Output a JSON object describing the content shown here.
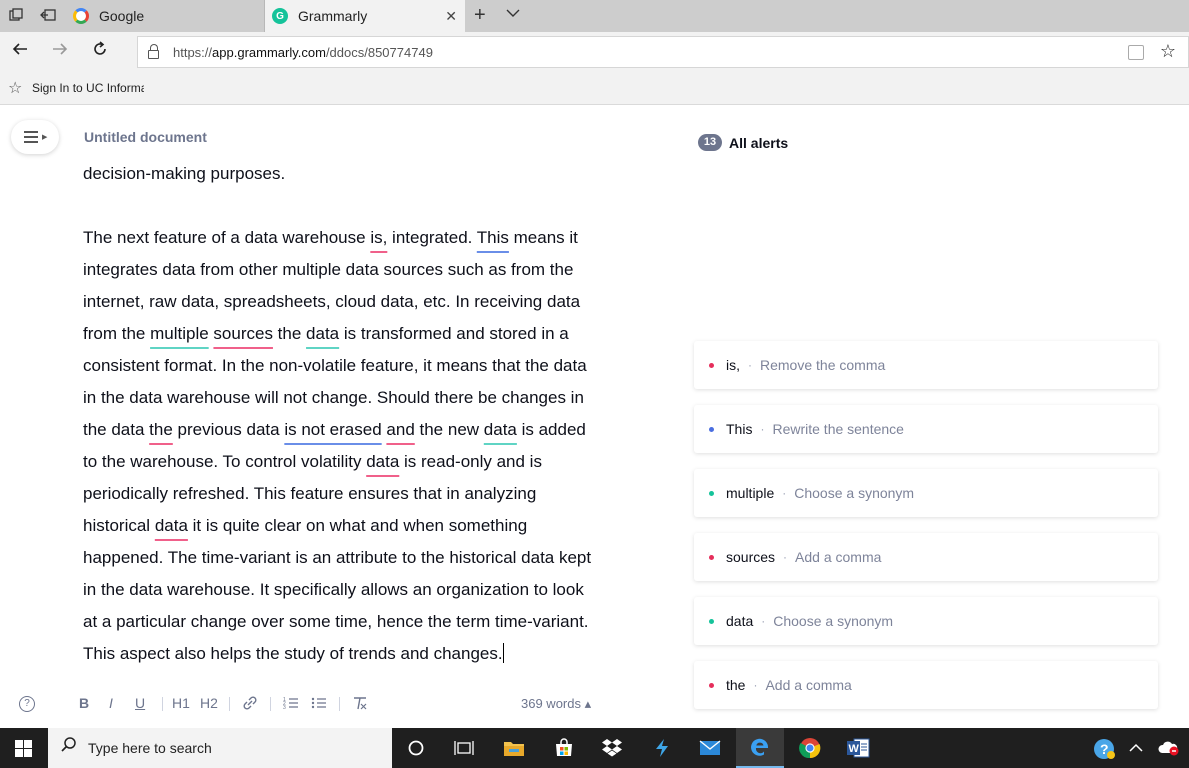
{
  "browser": {
    "tabs": [
      {
        "label": "Google",
        "active": false
      },
      {
        "label": "Grammarly",
        "active": true
      }
    ],
    "url_prefix": "https://",
    "url_domain": "app.grammarly.com",
    "url_path": "/ddocs/850774749",
    "favorites": [
      {
        "label": "Sign In to UC Informa"
      }
    ]
  },
  "editor": {
    "doc_title": "Untitled document",
    "prev_line": "decision-making purposes.",
    "lines": [
      [
        {
          "t": "The next feature of a data warehouse "
        },
        {
          "t": "is,",
          "u": "red"
        },
        {
          "t": " integrated. "
        },
        {
          "t": "This",
          "u": "blue"
        },
        {
          "t": " means it"
        }
      ],
      [
        {
          "t": "integrates data from other multiple data sources such as from the"
        }
      ],
      [
        {
          "t": "internet, raw data, spreadsheets, cloud data, etc. In receiving data"
        }
      ],
      [
        {
          "t": "from the "
        },
        {
          "t": "multiple",
          "u": "green"
        },
        {
          "t": " "
        },
        {
          "t": "sources",
          "u": "red"
        },
        {
          "t": " the "
        },
        {
          "t": "data",
          "u": "green"
        },
        {
          "t": " is transformed and stored in a"
        }
      ],
      [
        {
          "t": "consistent format. In the non-volatile feature, it means that the data"
        }
      ],
      [
        {
          "t": "in the data warehouse will not change. Should there be changes in"
        }
      ],
      [
        {
          "t": "the data "
        },
        {
          "t": "the",
          "u": "red"
        },
        {
          "t": " previous data "
        },
        {
          "t": "is not erased",
          "u": "blue"
        },
        {
          "t": " "
        },
        {
          "t": "and",
          "u": "red"
        },
        {
          "t": " the new "
        },
        {
          "t": "data",
          "u": "green"
        },
        {
          "t": " is added"
        }
      ],
      [
        {
          "t": "to the warehouse. To control volatility "
        },
        {
          "t": "data",
          "u": "red"
        },
        {
          "t": " is read-only and is"
        }
      ],
      [
        {
          "t": "periodically refreshed. This feature ensures that in analyzing"
        }
      ],
      [
        {
          "t": "historical "
        },
        {
          "t": "data",
          "u": "red"
        },
        {
          "t": " it is quite clear on what and when something"
        }
      ],
      [
        {
          "t": "happened. The time-variant is an attribute to the historical data kept"
        }
      ],
      [
        {
          "t": "in the data warehouse. It specifically allows an organization to look"
        }
      ],
      [
        {
          "t": "at a particular change over some time, hence the term time-variant."
        }
      ],
      [
        {
          "t": "This aspect also helps the study of trends and changes."
        }
      ]
    ],
    "toolbar": {
      "bold": "B",
      "italic": "I",
      "underline": "U",
      "h1": "H1",
      "h2": "H2",
      "help": "?",
      "word_count": "369 words ▴"
    }
  },
  "alerts": {
    "count": "13",
    "title": "All alerts",
    "separator": "·",
    "cards": [
      {
        "word": "is,",
        "hint": "Remove the comma",
        "color": "#e52e5b"
      },
      {
        "word": "This",
        "hint": "Rewrite the sentence",
        "color": "#4a6ee0"
      },
      {
        "word": "multiple",
        "hint": "Choose a synonym",
        "color": "#15c39a"
      },
      {
        "word": "sources",
        "hint": "Add a comma",
        "color": "#e52e5b"
      },
      {
        "word": "data",
        "hint": "Choose a synonym",
        "color": "#15c39a"
      },
      {
        "word": "the",
        "hint": "Add a comma",
        "color": "#e52e5b"
      }
    ]
  },
  "taskbar": {
    "search_placeholder": "Type here to search",
    "word_app_letter": "W"
  },
  "colors": {
    "red_alert": "#e52e5b",
    "blue_alert": "#4a6ee0",
    "green_alert": "#15c39a",
    "grammarly_brand": "#15c39a"
  }
}
